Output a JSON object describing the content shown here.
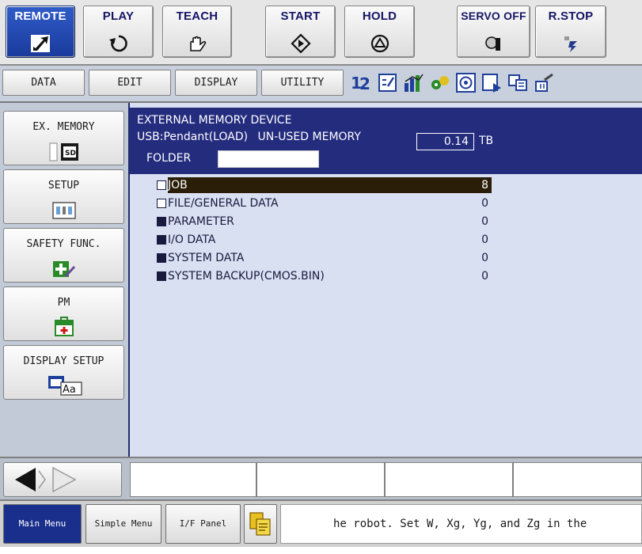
{
  "top_buttons": [
    {
      "label": "REMOTE",
      "icon": "remote-arrow-icon"
    },
    {
      "label": "PLAY",
      "icon": "play-cycle-icon"
    },
    {
      "label": "TEACH",
      "icon": "teach-hand-icon"
    },
    {
      "label": "START",
      "icon": "start-diamond-icon"
    },
    {
      "label": "HOLD",
      "icon": "hold-triangle-icon"
    },
    {
      "label": "SERVO OFF",
      "icon": "servo-off-icon"
    },
    {
      "label": "R.STOP",
      "icon": "r-stop-icon"
    }
  ],
  "tabs": [
    {
      "label": "DATA"
    },
    {
      "label": "EDIT"
    },
    {
      "label": "DISPLAY"
    },
    {
      "label": "UTILITY"
    }
  ],
  "tab_icons": [
    "number-sort-icon",
    "checklist-icon",
    "bar-chart-icon",
    "tools-icon",
    "target-window-icon",
    "document-arrow-icon",
    "multi-window-icon",
    "settings-icon"
  ],
  "side_menu": [
    {
      "label": "EX. MEMORY",
      "icon": "sd-card-icon"
    },
    {
      "label": "SETUP",
      "icon": "setup-panel-icon"
    },
    {
      "label": "SAFETY FUNC.",
      "icon": "safety-cross-icon"
    },
    {
      "label": "PM",
      "icon": "first-aid-icon"
    },
    {
      "label": "DISPLAY SETUP",
      "icon": "display-font-icon"
    }
  ],
  "main": {
    "title": "EXTERNAL MEMORY DEVICE",
    "device": "USB:Pendant(LOAD)",
    "unused_label": "UN-USED MEMORY",
    "unused_value": "0.14",
    "unused_unit": "TB",
    "folder_label": "FOLDER",
    "folder_value": "",
    "items": [
      {
        "name": "JOB",
        "count": "8",
        "selected": true,
        "checkbox": "empty"
      },
      {
        "name": "FILE/GENERAL DATA",
        "count": "0",
        "selected": false,
        "checkbox": "empty"
      },
      {
        "name": "PARAMETER",
        "count": "0",
        "selected": false,
        "checkbox": "filled"
      },
      {
        "name": "I/O DATA",
        "count": "0",
        "selected": false,
        "checkbox": "filled"
      },
      {
        "name": "SYSTEM DATA",
        "count": "0",
        "selected": false,
        "checkbox": "filled"
      },
      {
        "name": "SYSTEM BACKUP(CMOS.BIN)",
        "count": "0",
        "selected": false,
        "checkbox": "filled"
      }
    ]
  },
  "bottom": {
    "nav_icons": [
      "back-arrow-icon",
      "forward-arrow-icon"
    ]
  },
  "status_bar": {
    "main_menu": "Main Menu",
    "simple_menu": "Simple Menu",
    "if_panel": "I/F Panel",
    "clip_icon": "clipboard-icon",
    "message": "he robot. Set W, Xg, Yg, and Zg in the"
  },
  "colors": {
    "header_band": "#242c7e",
    "list_bg": "#d8e0f2",
    "remote_button": "#2f5cc8",
    "selected_row": "#2a1e08",
    "main_menu_button": "#1a2f8c"
  }
}
